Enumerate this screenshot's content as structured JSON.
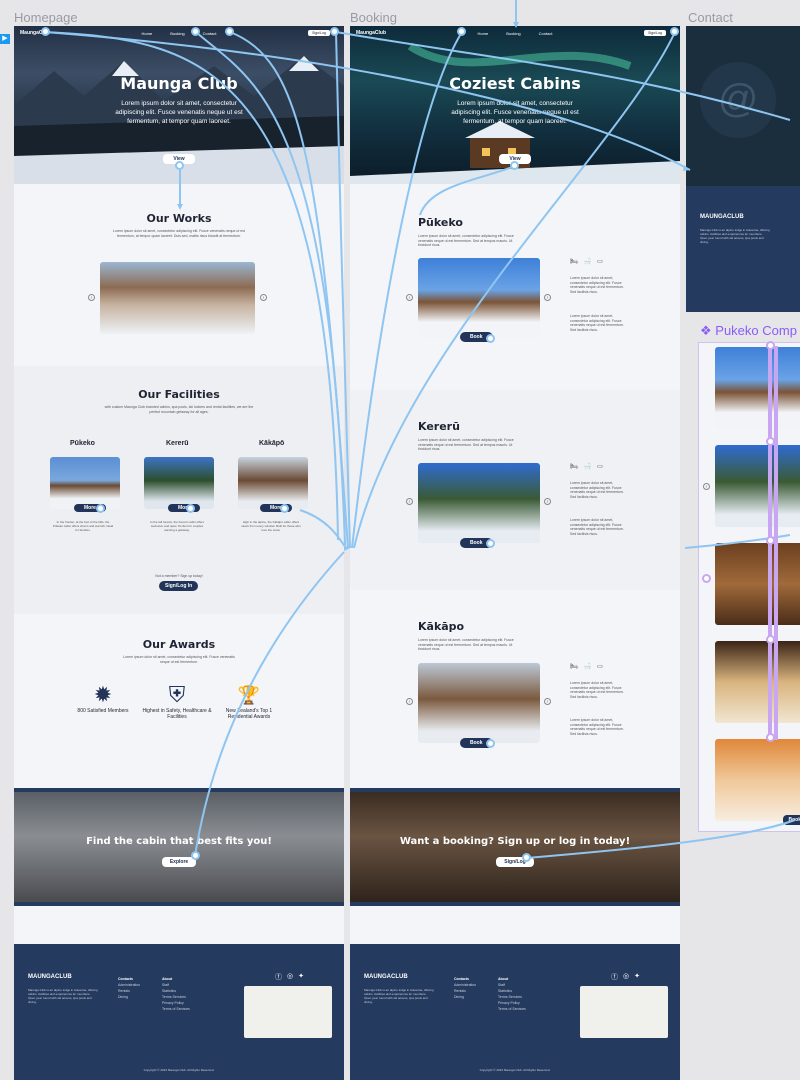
{
  "frames": {
    "homepage": "Homepage",
    "booking": "Booking",
    "contact": "Contact",
    "component": "Pukeko Comp"
  },
  "colors": {
    "navy": "#243a5e",
    "wire_blue": "#8ec5f1",
    "wire_purple": "#c9a6f2"
  },
  "nav": {
    "logo": "MaungaClub",
    "items": [
      "Home",
      "Booking",
      "Contact"
    ],
    "sign": "Sign/Log"
  },
  "home": {
    "hero_title": "Maunga Club",
    "hero_text": "Lorem ipsum dolor sit amet, consectetur adipiscing elit. Fusce venenatis neque ut est fermentum, at tempor quam laoreet.",
    "hero_button": "View",
    "works_title": "Our Works",
    "works_text": "Lorem ipsum dolor sit amet, consectetur adipiscing elit. Fusce venenatis neque ut est fermentum, at tempor quam laoreet. Duis sed, mattis risus blandit at fermentum.",
    "facilities_title": "Our Facilities",
    "facilities_text": "with custom Maunga Club branded cabins, spa pools, ski lockers and rental facilities, we are the perfect mountain getaway for all ages.",
    "facilities": [
      {
        "name": "Pūkeko",
        "button": "More",
        "text": "In the frontier, at the foot of the hills, the Pūkeko cabin offers charm and warmth. Ideal for families."
      },
      {
        "name": "Kererū",
        "button": "More",
        "text": "In the tall forests, the Kererū cabin offers seclusion and quiet. Perfect for couples wanting a getaway."
      },
      {
        "name": "Kākāpō",
        "button": "More",
        "text": "High in the alpine, the Kākāpō cabin offers views from every window. Built for those who love the snow."
      }
    ],
    "members_text": "Not a member? Sign up today!",
    "sign_button": "Sign/Log In",
    "awards_title": "Our Awards",
    "awards_text": "Lorem ipsum dolor sit amet, consectetur adipiscing elit. Fusce venenatis neque ut est fermentum.",
    "awards": [
      {
        "icon": "badge-icon",
        "glyph": "✹",
        "label": "800 Satisfied Members"
      },
      {
        "icon": "shield-check-icon",
        "glyph": "⛨",
        "label": "Highest in Safety, Healthcare & Facilities"
      },
      {
        "icon": "trophy-icon",
        "glyph": "🏆",
        "label": "New Zealand's Top 1 Residential Awards"
      }
    ],
    "cta_title": "Find the cabin that best fits you!",
    "cta_button": "Explore"
  },
  "booking": {
    "hero_title": "Coziest Cabins",
    "hero_text": "Lorem ipsum dolor sit amet, consectetur adipiscing elit. Fusce venenatis neque ut est fermentum, at tempor quam laoreet.",
    "hero_button": "View",
    "cabins": [
      {
        "name": "Pūkeko",
        "button": "Book"
      },
      {
        "name": "Kererū",
        "button": "Book"
      },
      {
        "name": "Kākāpo",
        "button": "Book"
      }
    ],
    "cabin_text": "Lorem ipsum dolor sit amet, consectetur adipiscing elit. Fusce venenatis neque ut est fermentum. Sed at tempus mauris. Ut tincidunt risus.",
    "amenities": [
      "4",
      "4",
      "2"
    ],
    "side_text": "Lorem ipsum dolor sit amet, consectetur adipiscing elit. Fusce venenatis neque ut est fermentum. Sed facilisis risus.",
    "cta_title": "Want a booking? Sign up or log in today!",
    "cta_button": "Sign/Log"
  },
  "footer": {
    "logo": "MAUNGACLUB",
    "text": "Maunga Club is an alpine lodge in Aotearoa, offering cabins, facilities and experiences for members. Open year round with ski access, spa pools and dining.",
    "col1_title": "Contacts",
    "col1": [
      "Administration",
      "Rentals",
      "Dining"
    ],
    "col2_title": "About",
    "col2": [
      "Staff",
      "Statistics",
      "Terms Services",
      "Privacy Policy",
      "Terms of Services"
    ],
    "copy": "Copyright © 2023 Maunga Club. All Rights Reserved."
  },
  "component": {
    "buttons": [
      "Book"
    ]
  }
}
